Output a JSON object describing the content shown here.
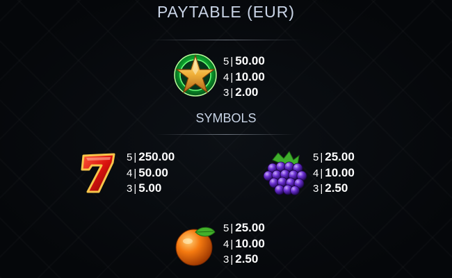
{
  "header": {
    "title": "PAYTABLE (EUR)"
  },
  "scatter": {
    "icon": "star-icon",
    "payouts": [
      {
        "count": "5",
        "value": "50.00"
      },
      {
        "count": "4",
        "value": "10.00"
      },
      {
        "count": "3",
        "value": "2.00"
      }
    ]
  },
  "symbols_section": {
    "title": "SYMBOLS"
  },
  "symbols": [
    {
      "icon": "seven-icon",
      "payouts": [
        {
          "count": "5",
          "value": "250.00"
        },
        {
          "count": "4",
          "value": "50.00"
        },
        {
          "count": "3",
          "value": "5.00"
        }
      ]
    },
    {
      "icon": "grapes-icon",
      "payouts": [
        {
          "count": "5",
          "value": "25.00"
        },
        {
          "count": "4",
          "value": "10.00"
        },
        {
          "count": "3",
          "value": "2.50"
        }
      ]
    },
    {
      "icon": "orange-icon",
      "payouts": [
        {
          "count": "5",
          "value": "25.00"
        },
        {
          "count": "4",
          "value": "10.00"
        },
        {
          "count": "3",
          "value": "2.50"
        }
      ]
    }
  ],
  "separator": "|",
  "colors": {
    "text": "#ffffff",
    "heading": "#c9d4e6",
    "background": "#06080b"
  }
}
